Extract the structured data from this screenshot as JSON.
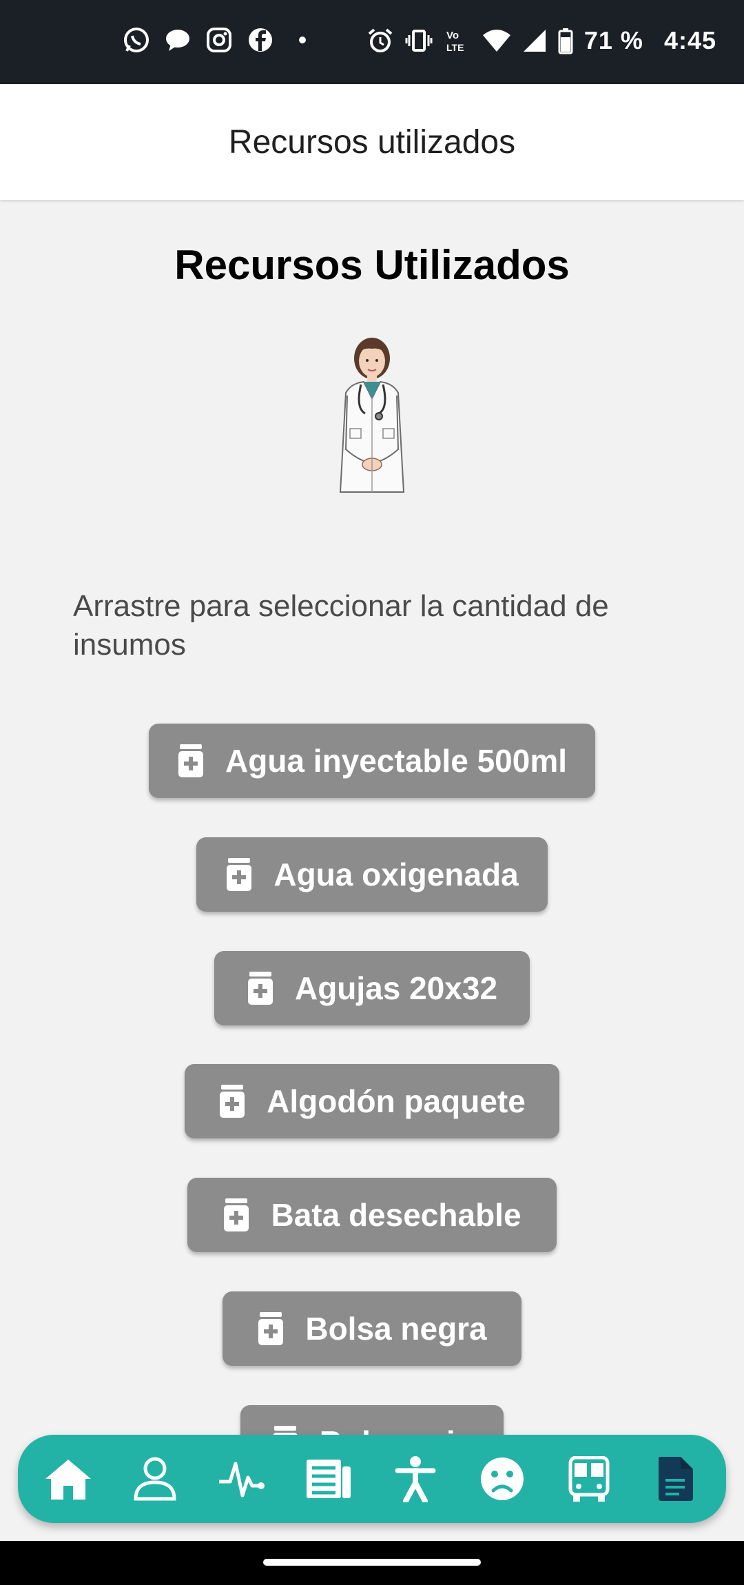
{
  "status_bar": {
    "battery": "71 %",
    "time": "4:45",
    "volte": "Vo LTE",
    "left_icons": [
      "whatsapp-icon",
      "chat-bubble-icon",
      "instagram-icon",
      "facebook-icon",
      "notification-dot"
    ],
    "right_icons": [
      "alarm-icon",
      "vibrate-icon",
      "volte-icon",
      "wifi-icon",
      "signal-icon",
      "battery-icon"
    ]
  },
  "app_bar": {
    "title": "Recursos utilizados"
  },
  "page": {
    "heading": "Recursos Utilizados",
    "illustration": "doctor-illustration",
    "instruction": "Arrastre para seleccionar la cantidad de insumos"
  },
  "supplies": [
    {
      "label": "Agua inyectable 500ml"
    },
    {
      "label": "Agua oxigenada"
    },
    {
      "label": "Agujas 20x32"
    },
    {
      "label": "Algodón paquete"
    },
    {
      "label": "Bata desechable"
    },
    {
      "label": "Bolsa negra"
    },
    {
      "label": "Bolsa roja"
    }
  ],
  "bottom_nav": {
    "background": "#22b3a6",
    "active_color": "#123a56",
    "items": [
      "home-icon",
      "user-icon",
      "heartbeat-icon",
      "newspaper-icon",
      "accessibility-icon",
      "sad-face-icon",
      "bus-icon",
      "document-icon"
    ],
    "active_index": 7
  },
  "colors": {
    "status_bar": "#1b1f26",
    "supply_button": "#8c8c8c",
    "background": "#f2f2f2"
  }
}
